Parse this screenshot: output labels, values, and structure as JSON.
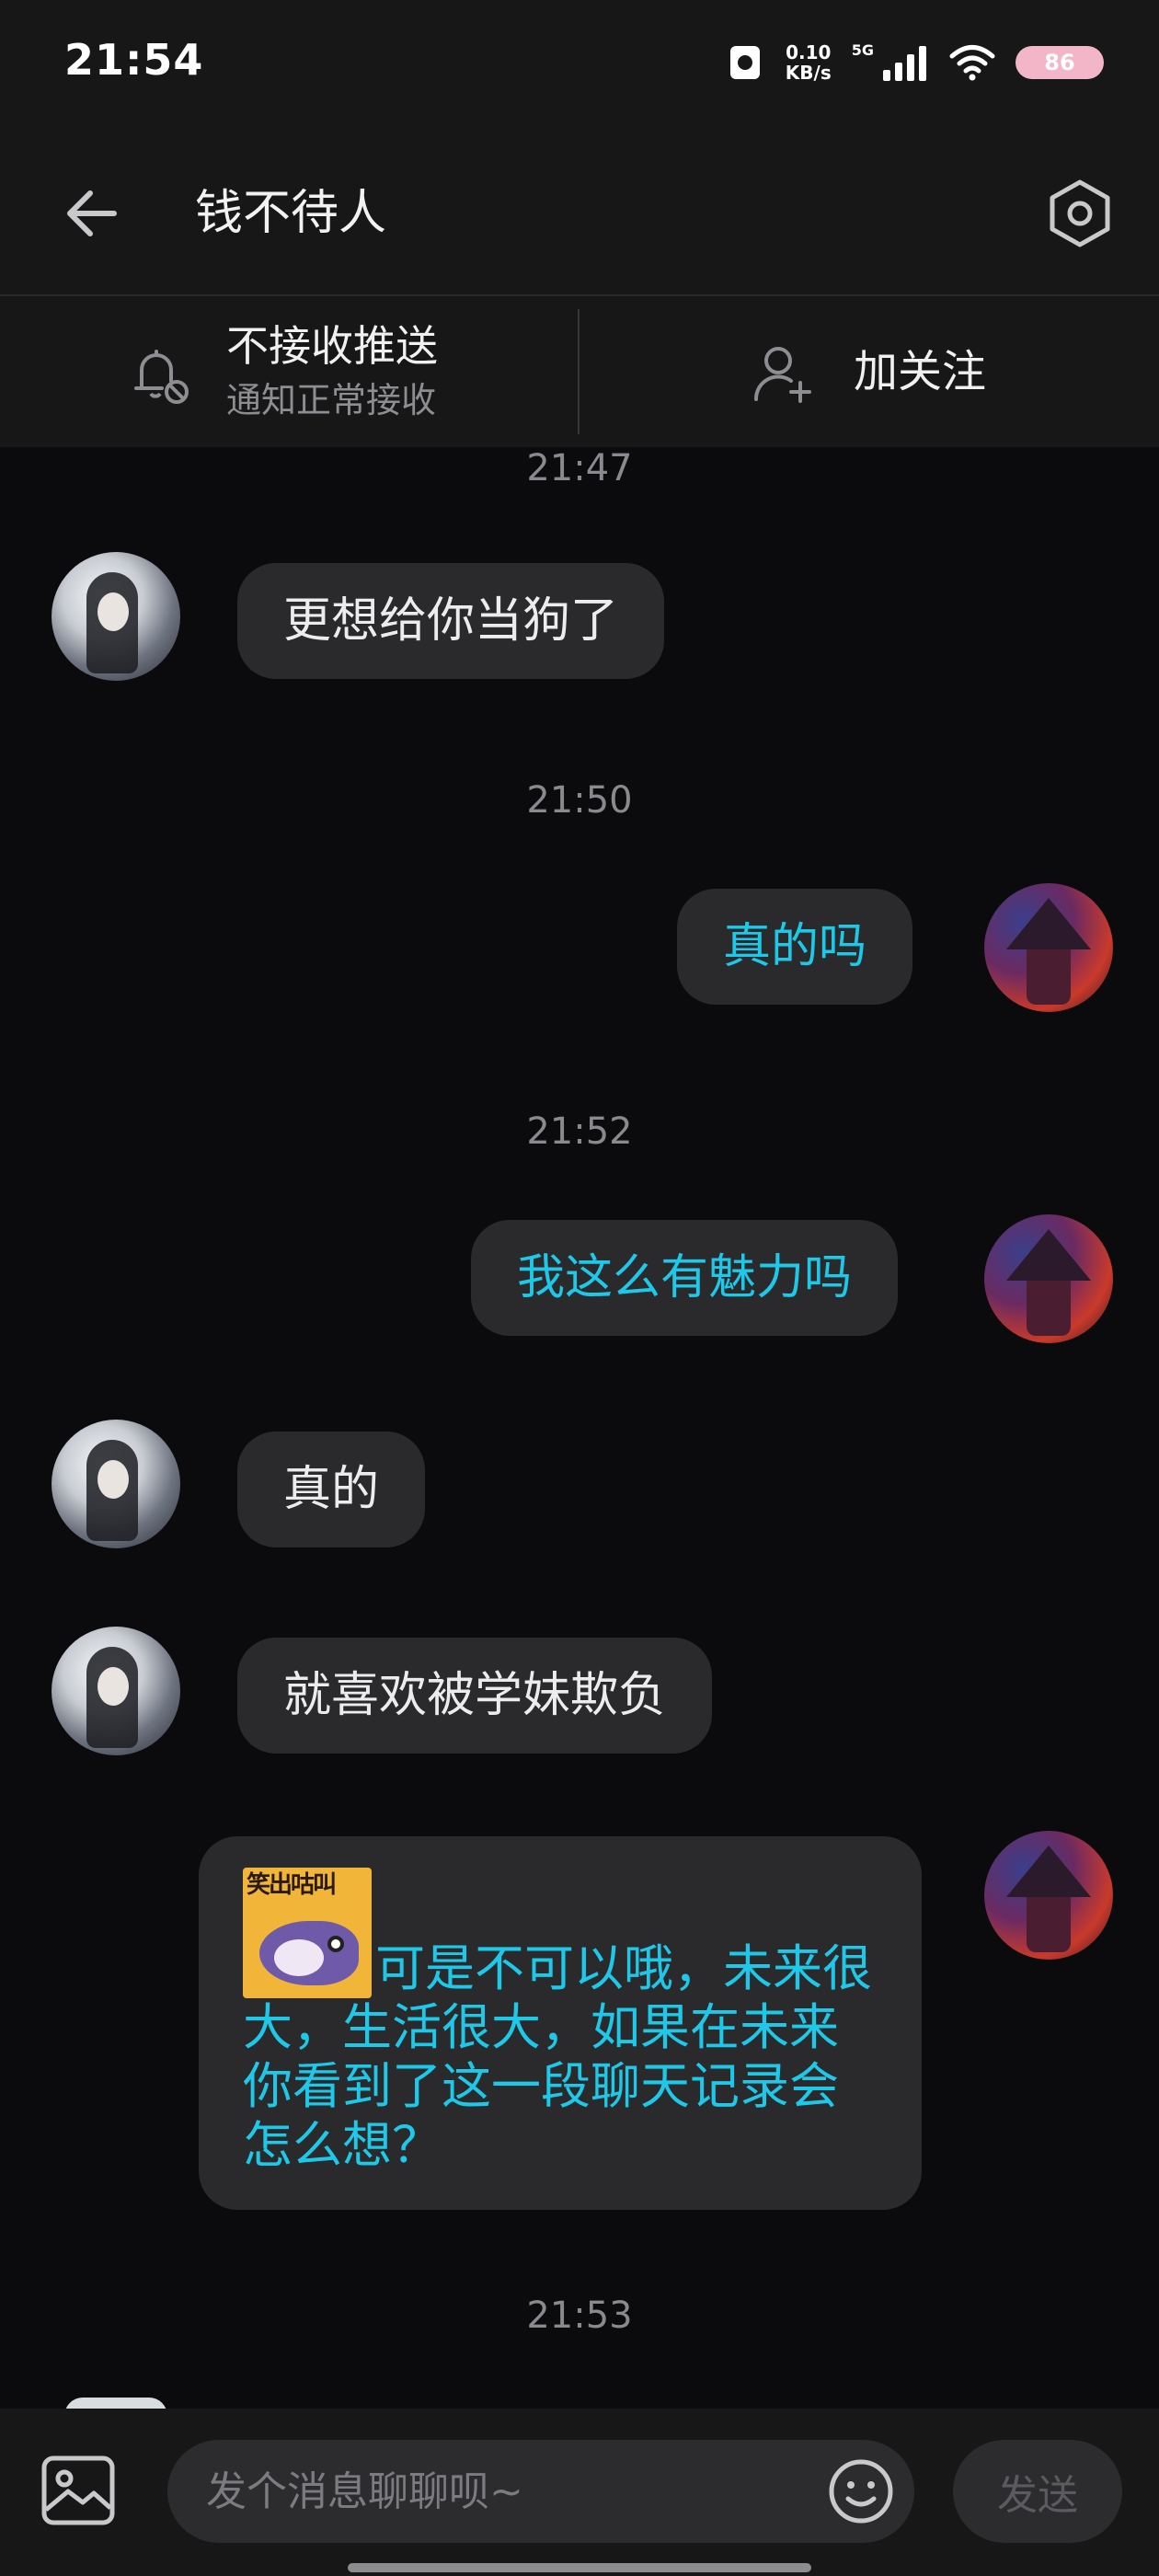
{
  "status_bar": {
    "time": "21:54",
    "net_speed_value": "0.10",
    "net_speed_unit": "KB/s",
    "network": "5G",
    "battery": "86"
  },
  "header": {
    "title": "钱不待人",
    "back_icon": "arrow-left-icon",
    "settings_icon": "hexagon-settings-icon"
  },
  "action_bar": {
    "push_title": "不接收推送",
    "push_subtitle": "通知正常接收",
    "follow_label": "加关注"
  },
  "messages": [
    {
      "type": "timestamp",
      "text": "21:47"
    },
    {
      "type": "in",
      "text": "更想给你当狗了"
    },
    {
      "type": "timestamp",
      "text": "21:50"
    },
    {
      "type": "out",
      "text": "真的吗"
    },
    {
      "type": "timestamp",
      "text": "21:52"
    },
    {
      "type": "out",
      "text": "我这么有魅力吗"
    },
    {
      "type": "in",
      "text": "真的"
    },
    {
      "type": "in",
      "text": "就喜欢被学妹欺负"
    },
    {
      "type": "out",
      "sticker_text": "笑出咕叫",
      "text": "可是不可以哦，未来很大，生活很大，如果在未来你看到了这一段聊天记录会怎么想？"
    },
    {
      "type": "timestamp",
      "text": "21:53"
    }
  ],
  "input_bar": {
    "placeholder": "发个消息聊聊呗~",
    "send_label": "发送",
    "image_icon": "image-icon",
    "emoji_icon": "smiley-icon"
  },
  "colors": {
    "background": "#0b0b0d",
    "bar": "#171718",
    "bubble": "#2a2a2d",
    "outgoing_text": "#1ec8e8"
  }
}
